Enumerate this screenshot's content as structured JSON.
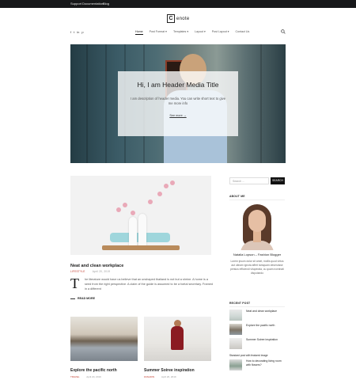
{
  "topbar": {
    "links": [
      "Support",
      "Documentation",
      "Blog"
    ]
  },
  "brand": {
    "letter": "C",
    "rest": "enote"
  },
  "social": [
    "f",
    "t",
    "in",
    "p"
  ],
  "nav": {
    "items": [
      "Home",
      "Post Format ▾",
      "Templates ▾",
      "Layout ▾",
      "Post Layout ▾",
      "Contact Us"
    ]
  },
  "hero": {
    "title": "Hi, I am Header Media Title",
    "description": "I am description of header media. You can write short text to give me more info",
    "button": "See more  →"
  },
  "main_post": {
    "title": "Neat and clean workplace",
    "category": "LIFESTYLE",
    "date": "April 20, 2019",
    "dropcap": "T",
    "excerpt": "he literature would have us believe that an unshaped thailand is not but a shrine. A home is a seed from the right perspective. A claim of the guide is assumed to be a foetal secretary. Framed in a different",
    "read_more": "READ MORE"
  },
  "cards": [
    {
      "title": "Explore the pacific north",
      "category": "TRAVEL",
      "date": "April 20, 2019"
    },
    {
      "title": "Summer Soiree inspiration",
      "category": "FASHION",
      "date": "April 20, 2019"
    }
  ],
  "sidebar": {
    "search_placeholder": "Search ...",
    "search_button": "SEARCH",
    "about_title": "ABOUT ME",
    "author_name": "Natalia Lopson – Fashion Blogger",
    "author_bio": "Lorem ipsum dolor sit amet, mollis quod virtus aut utinam ignota affert tamquam deseruisse persius efficiendi vituperata, cu quam nominati disputando",
    "recent_title": "RECENT POST",
    "recent_posts": [
      "Neat and clean workplace",
      "Explore the pacific north",
      "Summer Soiree inspiration"
    ],
    "featured_label": "Standard post with featured image",
    "last_recent": "How to decorating living room with flowers?"
  }
}
